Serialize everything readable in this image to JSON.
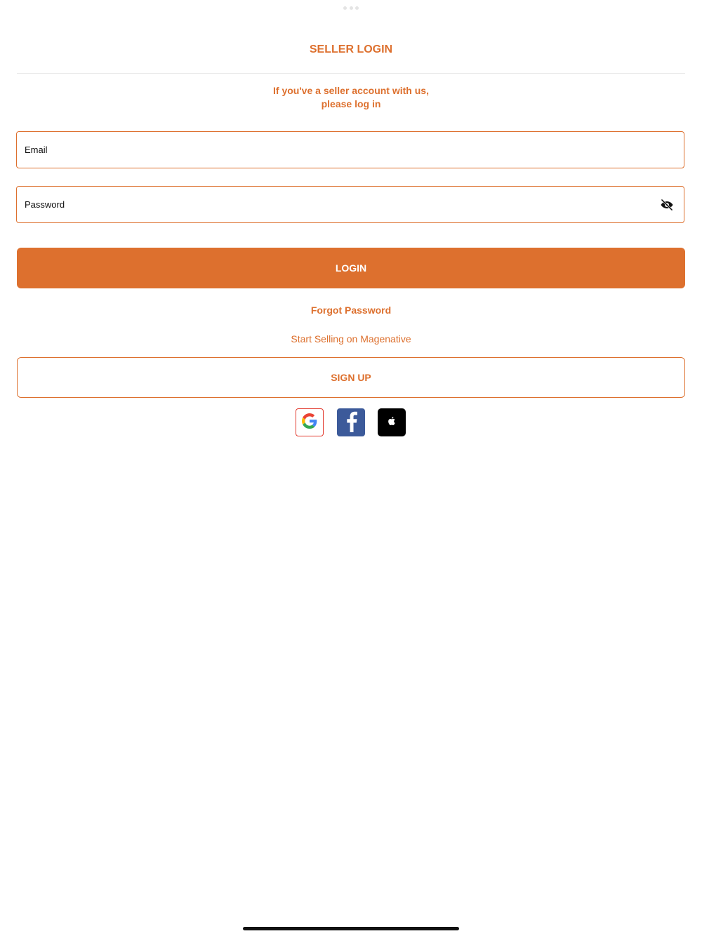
{
  "header": {
    "title": "SELLER LOGIN",
    "subtitle_line1": "If you've a seller account with us,",
    "subtitle_line2": "please log in"
  },
  "form": {
    "email_placeholder": "Email",
    "email_value": "",
    "password_placeholder": "Password",
    "password_value": "",
    "password_toggle_icon": "eye-slash-icon",
    "login_label": "LOGIN",
    "forgot_label": "Forgot Password",
    "start_selling_text": "Start Selling on Magenative",
    "signup_label": "SIGN UP"
  },
  "social_logins": [
    {
      "name": "Google",
      "icon": "google-icon"
    },
    {
      "name": "Facebook",
      "icon": "facebook-icon"
    },
    {
      "name": "Apple",
      "icon": "apple-icon"
    }
  ],
  "colors": {
    "accent": "#dd702e",
    "divider": "#e8e8e8",
    "facebook": "#3c5a9a",
    "apple": "#000000",
    "google_border": "#e23a2e"
  }
}
